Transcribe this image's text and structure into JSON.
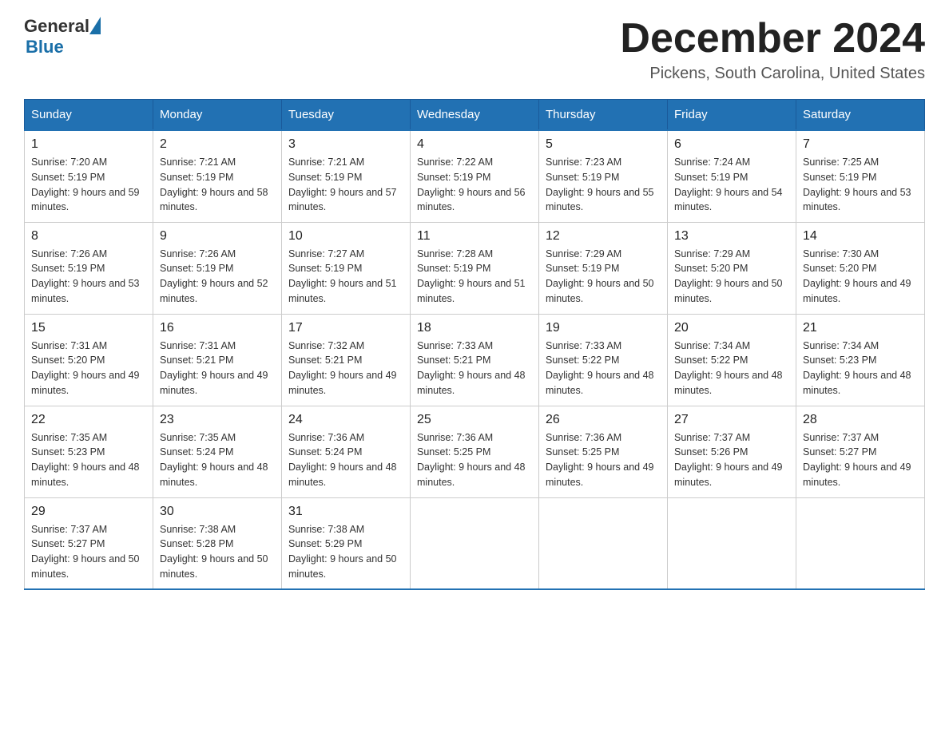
{
  "header": {
    "logo_general": "General",
    "logo_blue": "Blue",
    "month_title": "December 2024",
    "location": "Pickens, South Carolina, United States"
  },
  "weekdays": [
    "Sunday",
    "Monday",
    "Tuesday",
    "Wednesday",
    "Thursday",
    "Friday",
    "Saturday"
  ],
  "weeks": [
    [
      {
        "day": "1",
        "sunrise": "7:20 AM",
        "sunset": "5:19 PM",
        "daylight": "9 hours and 59 minutes."
      },
      {
        "day": "2",
        "sunrise": "7:21 AM",
        "sunset": "5:19 PM",
        "daylight": "9 hours and 58 minutes."
      },
      {
        "day": "3",
        "sunrise": "7:21 AM",
        "sunset": "5:19 PM",
        "daylight": "9 hours and 57 minutes."
      },
      {
        "day": "4",
        "sunrise": "7:22 AM",
        "sunset": "5:19 PM",
        "daylight": "9 hours and 56 minutes."
      },
      {
        "day": "5",
        "sunrise": "7:23 AM",
        "sunset": "5:19 PM",
        "daylight": "9 hours and 55 minutes."
      },
      {
        "day": "6",
        "sunrise": "7:24 AM",
        "sunset": "5:19 PM",
        "daylight": "9 hours and 54 minutes."
      },
      {
        "day": "7",
        "sunrise": "7:25 AM",
        "sunset": "5:19 PM",
        "daylight": "9 hours and 53 minutes."
      }
    ],
    [
      {
        "day": "8",
        "sunrise": "7:26 AM",
        "sunset": "5:19 PM",
        "daylight": "9 hours and 53 minutes."
      },
      {
        "day": "9",
        "sunrise": "7:26 AM",
        "sunset": "5:19 PM",
        "daylight": "9 hours and 52 minutes."
      },
      {
        "day": "10",
        "sunrise": "7:27 AM",
        "sunset": "5:19 PM",
        "daylight": "9 hours and 51 minutes."
      },
      {
        "day": "11",
        "sunrise": "7:28 AM",
        "sunset": "5:19 PM",
        "daylight": "9 hours and 51 minutes."
      },
      {
        "day": "12",
        "sunrise": "7:29 AM",
        "sunset": "5:19 PM",
        "daylight": "9 hours and 50 minutes."
      },
      {
        "day": "13",
        "sunrise": "7:29 AM",
        "sunset": "5:20 PM",
        "daylight": "9 hours and 50 minutes."
      },
      {
        "day": "14",
        "sunrise": "7:30 AM",
        "sunset": "5:20 PM",
        "daylight": "9 hours and 49 minutes."
      }
    ],
    [
      {
        "day": "15",
        "sunrise": "7:31 AM",
        "sunset": "5:20 PM",
        "daylight": "9 hours and 49 minutes."
      },
      {
        "day": "16",
        "sunrise": "7:31 AM",
        "sunset": "5:21 PM",
        "daylight": "9 hours and 49 minutes."
      },
      {
        "day": "17",
        "sunrise": "7:32 AM",
        "sunset": "5:21 PM",
        "daylight": "9 hours and 49 minutes."
      },
      {
        "day": "18",
        "sunrise": "7:33 AM",
        "sunset": "5:21 PM",
        "daylight": "9 hours and 48 minutes."
      },
      {
        "day": "19",
        "sunrise": "7:33 AM",
        "sunset": "5:22 PM",
        "daylight": "9 hours and 48 minutes."
      },
      {
        "day": "20",
        "sunrise": "7:34 AM",
        "sunset": "5:22 PM",
        "daylight": "9 hours and 48 minutes."
      },
      {
        "day": "21",
        "sunrise": "7:34 AM",
        "sunset": "5:23 PM",
        "daylight": "9 hours and 48 minutes."
      }
    ],
    [
      {
        "day": "22",
        "sunrise": "7:35 AM",
        "sunset": "5:23 PM",
        "daylight": "9 hours and 48 minutes."
      },
      {
        "day": "23",
        "sunrise": "7:35 AM",
        "sunset": "5:24 PM",
        "daylight": "9 hours and 48 minutes."
      },
      {
        "day": "24",
        "sunrise": "7:36 AM",
        "sunset": "5:24 PM",
        "daylight": "9 hours and 48 minutes."
      },
      {
        "day": "25",
        "sunrise": "7:36 AM",
        "sunset": "5:25 PM",
        "daylight": "9 hours and 48 minutes."
      },
      {
        "day": "26",
        "sunrise": "7:36 AM",
        "sunset": "5:25 PM",
        "daylight": "9 hours and 49 minutes."
      },
      {
        "day": "27",
        "sunrise": "7:37 AM",
        "sunset": "5:26 PM",
        "daylight": "9 hours and 49 minutes."
      },
      {
        "day": "28",
        "sunrise": "7:37 AM",
        "sunset": "5:27 PM",
        "daylight": "9 hours and 49 minutes."
      }
    ],
    [
      {
        "day": "29",
        "sunrise": "7:37 AM",
        "sunset": "5:27 PM",
        "daylight": "9 hours and 50 minutes."
      },
      {
        "day": "30",
        "sunrise": "7:38 AM",
        "sunset": "5:28 PM",
        "daylight": "9 hours and 50 minutes."
      },
      {
        "day": "31",
        "sunrise": "7:38 AM",
        "sunset": "5:29 PM",
        "daylight": "9 hours and 50 minutes."
      },
      null,
      null,
      null,
      null
    ]
  ]
}
